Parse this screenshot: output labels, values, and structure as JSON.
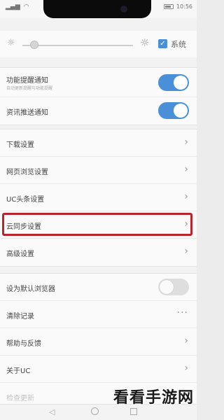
{
  "status_bar": {
    "time": "10:56",
    "left_icons": [
      "signal-icon",
      "wifi-icon"
    ],
    "right_icons": [
      "battery-icon"
    ]
  },
  "brightness": {
    "system_label": "系统",
    "system_checked": true,
    "level": 0.06
  },
  "notifications": {
    "items": [
      {
        "label": "功能提醒通知",
        "sub": "自动更新提醒与功能提醒",
        "toggle": true
      },
      {
        "label": "资讯推送通知",
        "toggle": true
      }
    ]
  },
  "settings": {
    "items": [
      {
        "label": "下载设置"
      },
      {
        "label": "网页浏览设置"
      },
      {
        "label": "UC头条设置"
      },
      {
        "label": "云同步设置",
        "highlighted": true
      },
      {
        "label": "高级设置"
      }
    ]
  },
  "other": {
    "default_browser": {
      "label": "设为默认浏览器",
      "toggle": false
    },
    "clear_history": {
      "label": "清除记录",
      "more": "···"
    },
    "help": {
      "label": "帮助与反馈"
    },
    "about": {
      "label": "关于UC"
    },
    "check_update": {
      "label": "检查更新"
    }
  },
  "watermark": "看看手游网",
  "colors": {
    "accent": "#4a90d9",
    "highlight_border": "#b8252c"
  }
}
